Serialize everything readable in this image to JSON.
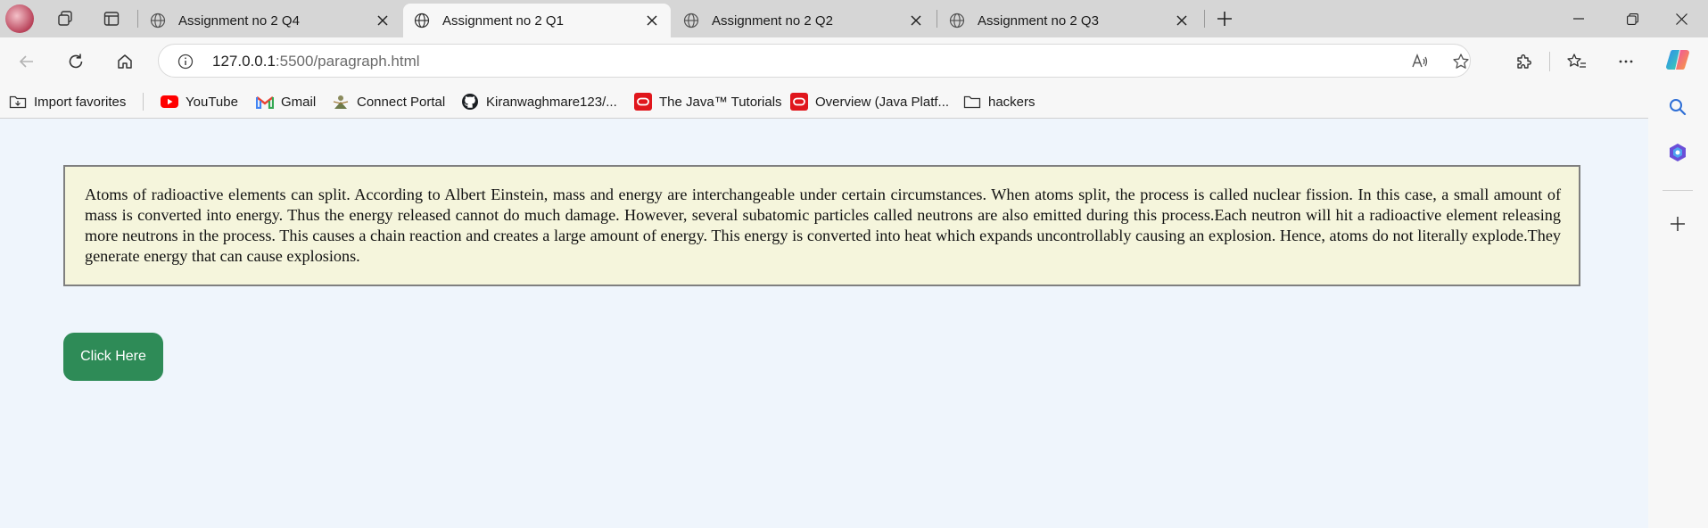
{
  "browser": {
    "tabs": [
      {
        "label": "Assignment no 2 Q4",
        "active": false
      },
      {
        "label": "Assignment no 2 Q1",
        "active": true
      },
      {
        "label": "Assignment no 2 Q2",
        "active": false
      },
      {
        "label": "Assignment no 2 Q3",
        "active": false
      }
    ],
    "address": {
      "host": "127.0.0.1",
      "path": ":5500/paragraph.html"
    },
    "favorites": [
      {
        "label": "Import favorites",
        "icon": "folder-import-icon"
      },
      {
        "label": "YouTube",
        "icon": "youtube-icon"
      },
      {
        "label": "Gmail",
        "icon": "gmail-icon"
      },
      {
        "label": "Connect Portal",
        "icon": "connect-portal-icon"
      },
      {
        "label": "Kiranwaghmare123/...",
        "icon": "github-icon"
      },
      {
        "label": "The Java™ Tutorials",
        "icon": "oracle-icon"
      },
      {
        "label": "Overview (Java Platf...",
        "icon": "oracle-icon"
      },
      {
        "label": "hackers",
        "icon": "folder-icon"
      }
    ],
    "colors": {
      "accent_green": "#2e8b57",
      "para_bg": "#f5f5dc",
      "page_bg": "#eff5fc"
    }
  },
  "page": {
    "paragraph": "Atoms of radioactive elements can split. According to Albert Einstein, mass and energy are interchangeable under certain circumstances. When atoms split, the process is called nuclear fission. In this case, a small amount of mass is converted into energy. Thus the energy released cannot do much damage. However, several subatomic particles called neutrons are also emitted during this process.Each neutron will hit a radioactive element releasing more neutrons in the process. This causes a chain reaction and creates a large amount of energy. This energy is converted into heat which expands uncontrollably causing an explosion. Hence, atoms do not literally explode.They generate energy that can cause explosions.",
    "button_label": "Click Here"
  }
}
